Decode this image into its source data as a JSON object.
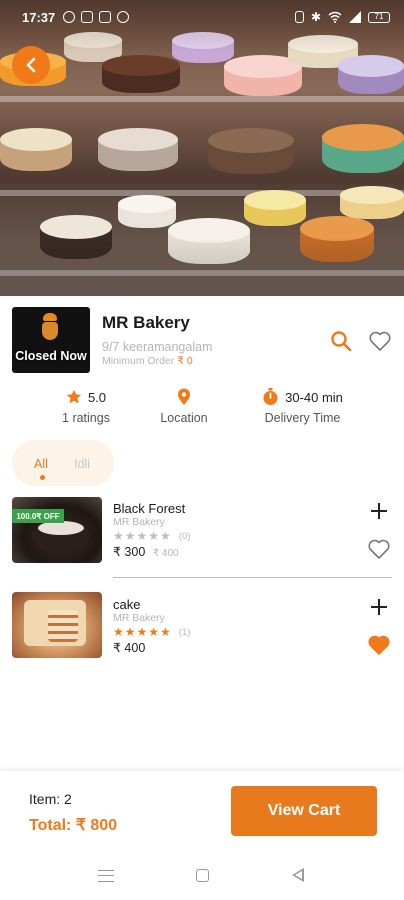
{
  "status_bar": {
    "time": "17:37",
    "battery": "71"
  },
  "store": {
    "logo_status": "Closed Now",
    "name": "MR Bakery",
    "address": "9/7 keeramangalam",
    "min_order_label": "Minimum Order",
    "min_order_value": "₹ 0"
  },
  "stats": {
    "rating_value": "5.0",
    "rating_label": "1 ratings",
    "location_label": "Location",
    "delivery_value": "30-40 min",
    "delivery_label": "Delivery Time"
  },
  "categories": [
    {
      "label": "All",
      "active": true
    },
    {
      "label": "Idli",
      "active": false
    }
  ],
  "products": [
    {
      "name": "Black Forest",
      "store": "MR Bakery",
      "rating": 0,
      "rating_count": "(0)",
      "price": "₹ 300",
      "old_price": "₹ 400",
      "discount": "100.0₹ OFF",
      "favorite": false
    },
    {
      "name": "cake",
      "store": "MR Bakery",
      "rating": 5,
      "rating_count": "(1)",
      "price": "₹ 400",
      "old_price": "",
      "discount": "",
      "favorite": true
    }
  ],
  "cart": {
    "items_label": "Item: 2",
    "total_label": "Total: ₹ 800",
    "button_label": "View Cart"
  },
  "colors": {
    "accent": "#f07a1a",
    "star_empty": "#bdbdbd",
    "discount_badge": "#3aa34a",
    "favorite_active": "#f07a1a"
  }
}
